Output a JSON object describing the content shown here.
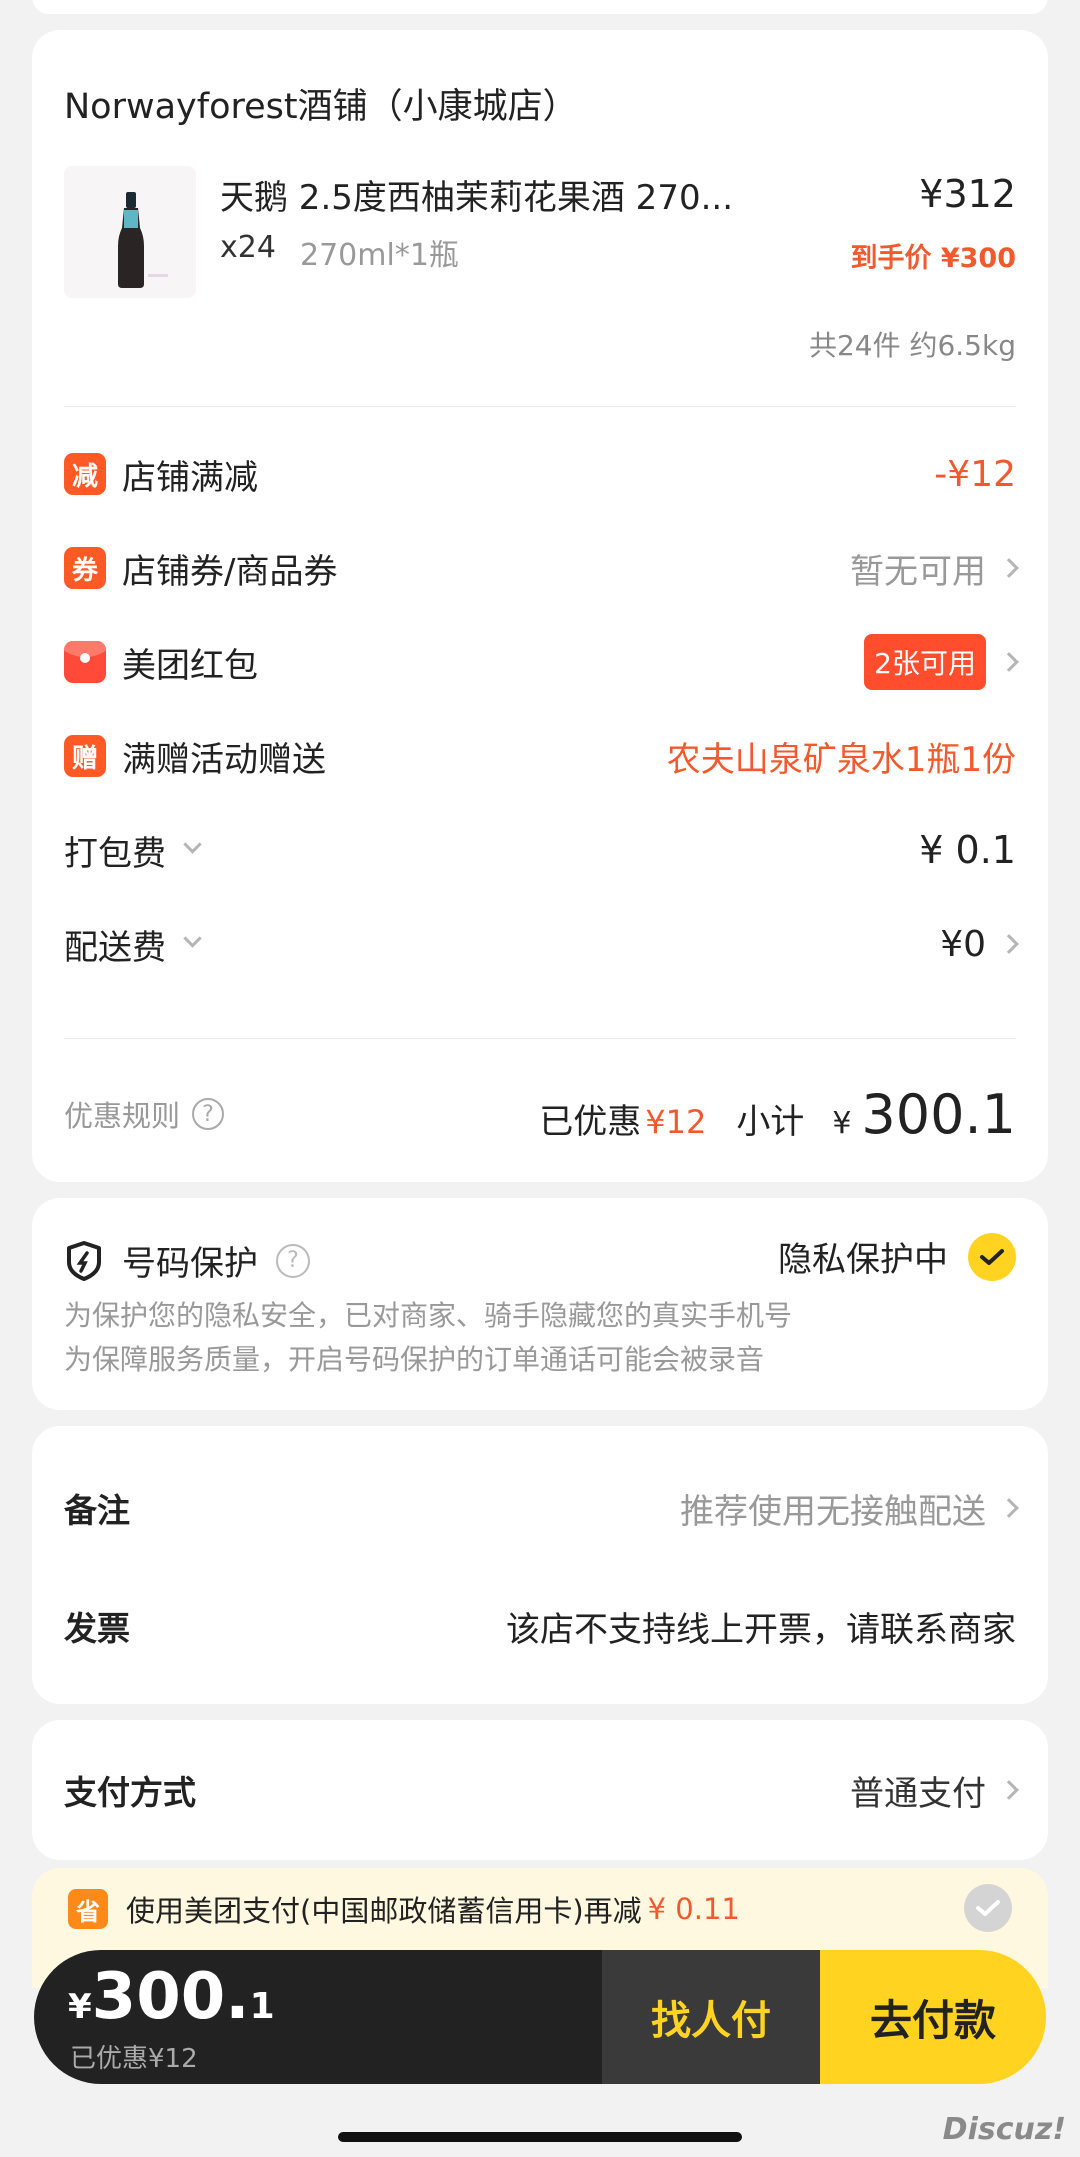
{
  "shop": {
    "name": "Norwayforest酒铺（小康城店）",
    "product": {
      "title": "天鹅 2.5度西柚茉莉花果酒 270...",
      "qty": "x24",
      "spec": "270ml*1瓶",
      "price": "¥312",
      "final_price": "到手价 ¥300"
    },
    "total_info": "共24件 约6.5kg",
    "rows": {
      "discount": {
        "tag": "减",
        "label": "店铺满减",
        "value": "-¥12"
      },
      "coupon": {
        "tag": "券",
        "label": "店铺券/商品券",
        "value": "暂无可用"
      },
      "redpacket": {
        "label": "美团红包",
        "badge": "2张可用"
      },
      "gift": {
        "tag": "赠",
        "label": "满赠活动赠送",
        "value": "农夫山泉矿泉水1瓶1份"
      },
      "packing": {
        "label": "打包费",
        "value": "¥ 0.1"
      },
      "delivery": {
        "label": "配送费",
        "value": "¥0"
      }
    },
    "summary": {
      "rules_label": "优惠规则",
      "saved_label": "已优惠",
      "saved_value": "¥12",
      "subtotal_label": "小计",
      "subtotal_currency": "¥",
      "subtotal_value": "300.1"
    }
  },
  "privacy": {
    "title": "号码保护",
    "status": "隐私保护中",
    "line1": "为保护您的隐私安全，已对商家、骑手隐藏您的真实手机号",
    "line2": "为保障服务质量，开启号码保护的订单通话可能会被录音"
  },
  "notes": {
    "remark_label": "备注",
    "remark_value": "推荐使用无接触配送",
    "invoice_label": "发票",
    "invoice_value": "该店不支持线上开票，请联系商家"
  },
  "payment": {
    "label": "支付方式",
    "value": "普通支付"
  },
  "promo": {
    "icon_text": "省",
    "text": "使用美团支付(中国邮政储蓄信用卡)再减",
    "amount": "¥ 0.11"
  },
  "bottom_bar": {
    "currency": "¥",
    "amount_int": "300.",
    "amount_dec": "1",
    "saved": "已优惠¥12",
    "friend_pay": "找人付",
    "pay": "去付款"
  },
  "watermark": "Discuz!",
  "colors": {
    "accent_red": "#f25a2d",
    "brand_yellow": "#ffd31f",
    "dark_bar": "#222222"
  }
}
